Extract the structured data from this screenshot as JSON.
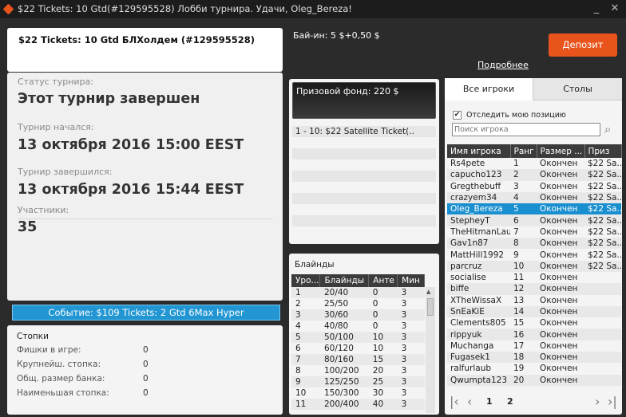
{
  "window": {
    "title": "$22 Tickets: 10 Gtd(#129595528) Лобби турнира. Удачи, Oleg_Bereza!",
    "minimize": "_",
    "close": "✕"
  },
  "header": {
    "tournament_name": "$22 Tickets: 10 Gtd БЛХолдем (#129595528)",
    "buyin": "Бай-ин: 5 $+0,50 $",
    "deposit": "Депозит",
    "more": "Подробнее"
  },
  "status": {
    "status_label": "Статус турнира:",
    "status_value": "Этот турнир завершен",
    "started_label": "Турнир начался:",
    "started_date": "13 октября 2016",
    "started_time": "15:00 EEST",
    "ended_label": "Турнир завершился:",
    "ended_date": "13 октября 2016",
    "ended_time": "15:44 EEST",
    "players_label": "Участники:",
    "players_value": "35"
  },
  "event_banner": "Событие: $109 Tickets: 2 Gtd 6Max Hyper",
  "stacks": {
    "title": "Стопки",
    "rows": [
      {
        "label": "Фишки в игре:",
        "value": "0"
      },
      {
        "label": "Крупнейш. стопка:",
        "value": "0"
      },
      {
        "label": "Общ. размер банка:",
        "value": "0"
      },
      {
        "label": "Наименьшая стопка:",
        "value": "0"
      }
    ]
  },
  "prize": {
    "title": "Призовой фонд: 220 $",
    "rows": [
      "1 - 10: $22 Satellite Ticket(.."
    ]
  },
  "blinds": {
    "title": "Блайнды",
    "columns": [
      "Уро...",
      "Блайнды",
      "Анте",
      "Мин"
    ],
    "rows": [
      [
        "1",
        "20/40",
        "0",
        "3"
      ],
      [
        "2",
        "25/50",
        "0",
        "3"
      ],
      [
        "3",
        "30/60",
        "0",
        "3"
      ],
      [
        "4",
        "40/80",
        "0",
        "3"
      ],
      [
        "5",
        "50/100",
        "10",
        "3"
      ],
      [
        "6",
        "60/120",
        "10",
        "3"
      ],
      [
        "7",
        "80/160",
        "15",
        "3"
      ],
      [
        "8",
        "100/200",
        "20",
        "3"
      ],
      [
        "9",
        "125/250",
        "25",
        "3"
      ],
      [
        "10",
        "150/300",
        "30",
        "3"
      ],
      [
        "11",
        "200/400",
        "40",
        "3"
      ]
    ]
  },
  "players": {
    "tab_all": "Все игроки",
    "tab_tables": "Столы",
    "track_label": "Отследить мою позицию",
    "search_placeholder": "Поиск игрока",
    "columns": [
      "Имя игрока",
      "Ранг",
      "Размер ...",
      "Приз"
    ],
    "rows": [
      [
        "Rs4pete",
        "1",
        "Окончен",
        "$22 Sa..."
      ],
      [
        "capucho123",
        "2",
        "Окончен",
        "$22 Sa..."
      ],
      [
        "Gregthebuff",
        "3",
        "Окончен",
        "$22 Sa..."
      ],
      [
        "crazyem34",
        "4",
        "Окончен",
        "$22 Sa..."
      ],
      [
        "Oleg_Bereza",
        "5",
        "Окончен",
        "$22 Sa..."
      ],
      [
        "StepheyT",
        "6",
        "Окончен",
        "$22 Sa..."
      ],
      [
        "TheHitmanLau",
        "7",
        "Окончен",
        "$22 Sa..."
      ],
      [
        "Gav1n87",
        "8",
        "Окончен",
        "$22 Sa..."
      ],
      [
        "MattHill1992",
        "9",
        "Окончен",
        "$22 Sa..."
      ],
      [
        "parcruz",
        "10",
        "Окончен",
        "$22 Sa..."
      ],
      [
        "socialise",
        "11",
        "Окончен",
        ""
      ],
      [
        "biffe",
        "12",
        "Окончен",
        ""
      ],
      [
        "XTheWissaX",
        "13",
        "Окончен",
        ""
      ],
      [
        "SnEaKiE",
        "14",
        "Окончен",
        ""
      ],
      [
        "Clements805",
        "15",
        "Окончен",
        ""
      ],
      [
        "rippyuk",
        "16",
        "Окончен",
        ""
      ],
      [
        "Muchanga",
        "17",
        "Окончен",
        ""
      ],
      [
        "Fugasek1",
        "18",
        "Окончен",
        ""
      ],
      [
        "ralfurlaub",
        "19",
        "Окончен",
        ""
      ],
      [
        "Qwumpta123",
        "20",
        "Окончен",
        ""
      ]
    ],
    "selected_index": 4,
    "pages": [
      "1",
      "2"
    ]
  },
  "colors": {
    "accent": "#e8541c",
    "selection": "#1a8fd0",
    "banner": "#2196d3"
  }
}
